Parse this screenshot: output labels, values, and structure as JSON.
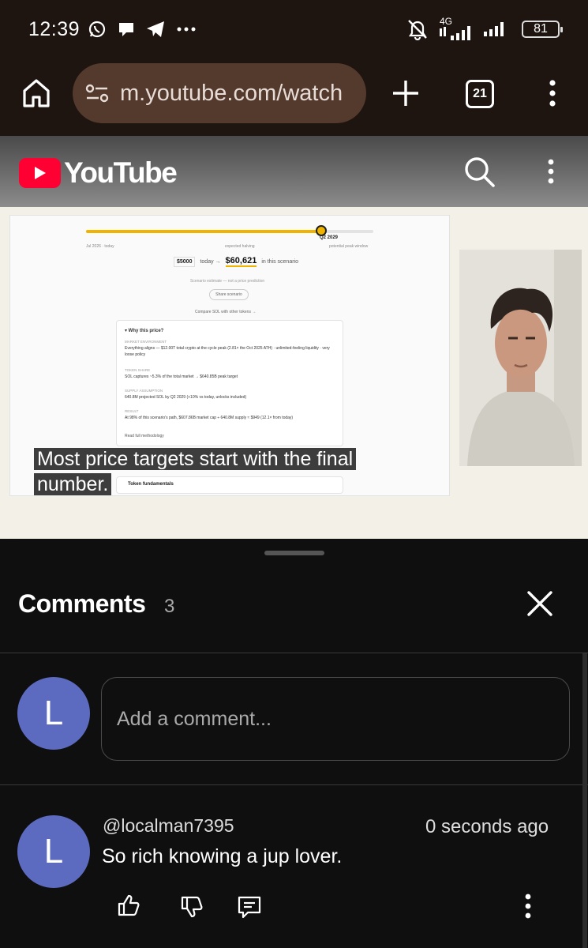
{
  "status_bar": {
    "time": "12:39",
    "network": "4G",
    "battery": "81"
  },
  "browser": {
    "url": "m.youtube.com/watch",
    "tab_count": "21"
  },
  "youtube": {
    "wordmark": "YouTube"
  },
  "video": {
    "caption_line1": "Most price targets start with the final",
    "caption_line2": "number.",
    "slide": {
      "timeline_progress": 0.82,
      "timeline_labels": [
        "Jul 2026 · today",
        "expected halving",
        "potential peak window"
      ],
      "timeline_point": "Q2 2029",
      "amount": "$5000",
      "today_text": "today →",
      "scenario_value": "$60,621",
      "scenario_suffix": "in this scenario",
      "scenario_note": "Scenario estimate — not a price prediction",
      "share_label": "Share scenario",
      "compare_label": "Compare SOL with other tokens →",
      "why_title": "▾  Why this price?",
      "sections": [
        {
          "label": "MARKET ENVIRONMENT",
          "text": "Everything aligns — $12.00T total crypto at the cycle peak (2.81× the Oct 2025 ATH) · unlimited-feeling liquidity · very loose policy"
        },
        {
          "label": "TOKEN SHARE",
          "text": "SOL captures ~5.3% of the total market → $640.85B peak target"
        },
        {
          "label": "SUPPLY ASSUMPTION",
          "text": "640.8M projected SOL by Q2 2029 (+10% vs today, unlocks included)"
        },
        {
          "label": "RESULT",
          "text": "At 98% of this scenario's path, $607.86B market cap ÷ 640.8M supply ≈ $949 (12.1× from today)"
        }
      ],
      "methodology_link": "Read full methodology",
      "token_fundamentals": "Token fundamentals"
    }
  },
  "comments": {
    "title": "Comments",
    "count": "3",
    "input_placeholder": "Add a comment...",
    "user_avatar_letter": "L",
    "items": [
      {
        "avatar_letter": "L",
        "author": "@localman7395",
        "time": "0 seconds ago",
        "text": "So rich knowing a jup lover."
      }
    ]
  },
  "colors": {
    "status_bg": "#1e1410",
    "url_pill": "#54392d",
    "youtube_red": "#ff0033",
    "avatar": "#5c6bc0",
    "sheet_bg": "#0f0f0f",
    "accent_yellow": "#f0b400"
  }
}
